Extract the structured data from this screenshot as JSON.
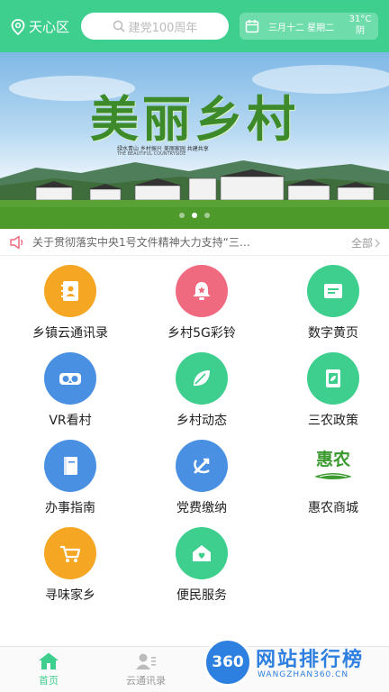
{
  "header": {
    "location": "天心区",
    "search_placeholder": "建党100周年",
    "date": "三月十二 星期二",
    "weather_temp": "31°C",
    "weather_desc": "阴"
  },
  "banner": {
    "title": "美丽乡村",
    "subtitle": "绿水青山 乡村振兴 美丽家园 共建共享",
    "subtitle_en": "THE BEAUTIFUL COUNTRYSIDE",
    "page_count": 3,
    "active_index": 1
  },
  "notice": {
    "text": "关于贯彻落实中央1号文件精神大力支持“三…",
    "more": "全部"
  },
  "grid": [
    {
      "label": "乡镇云通讯录",
      "icon": "contacts-icon",
      "color": "#f5a623"
    },
    {
      "label": "乡村5G彩铃",
      "icon": "bell-icon",
      "color": "#f06a7f"
    },
    {
      "label": "数字黄页",
      "icon": "yellow-pages-icon",
      "color": "#3ecf8e"
    },
    {
      "label": "VR看村",
      "icon": "vr-icon",
      "color": "#4a90e2"
    },
    {
      "label": "乡村动态",
      "icon": "leaf-icon",
      "color": "#3ecf8e"
    },
    {
      "label": "三农政策",
      "icon": "policy-icon",
      "color": "#3ecf8e"
    },
    {
      "label": "办事指南",
      "icon": "guide-book-icon",
      "color": "#4a90e2"
    },
    {
      "label": "党费缴纳",
      "icon": "party-emblem-icon",
      "color": "#4a90e2"
    },
    {
      "label": "惠农商城",
      "icon": "huinong-logo",
      "color": "#3a9a2e",
      "logo_text": "惠农"
    },
    {
      "label": "寻味家乡",
      "icon": "cart-icon",
      "color": "#f5a623"
    },
    {
      "label": "便民服务",
      "icon": "home-service-icon",
      "color": "#3ecf8e"
    }
  ],
  "tabbar": {
    "tabs": [
      {
        "label": "首页",
        "icon": "home-icon",
        "active": true
      },
      {
        "label": "云通讯录",
        "icon": "contact-icon",
        "active": false
      },
      {
        "label": "",
        "icon": "tab3-icon",
        "active": false
      },
      {
        "label": "",
        "icon": "tab4-icon",
        "active": false
      }
    ]
  },
  "watermark": {
    "badge": "360",
    "title": "网站排行榜",
    "url": "WANGZHAN360.CN"
  },
  "colors": {
    "accent": "#3ecf8e",
    "orange": "#f5a623",
    "blue": "#4a90e2",
    "pink": "#f06a7f"
  }
}
